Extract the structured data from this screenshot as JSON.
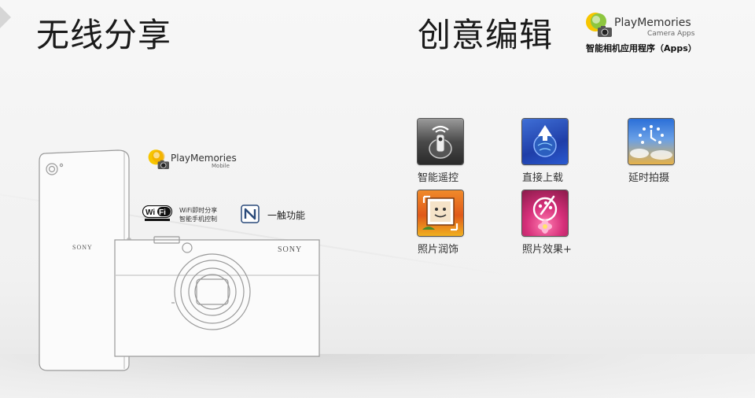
{
  "sections": {
    "wireless_title": "无线分享",
    "creative_title": "创意编辑"
  },
  "logos": {
    "camera_apps": {
      "name": "PlayMemories",
      "sub": "Camera Apps",
      "caption": "智能相机应用程序（Apps）"
    },
    "mobile": {
      "name": "PlayMemories",
      "sub": "Mobile"
    }
  },
  "features": {
    "wifi_badge_icon": "wifi-certified-icon",
    "wifi_line1": "WiFi即时分享",
    "wifi_line2": "智能手机控制",
    "nfc_icon": "nfc-icon",
    "nfc_label": "一触功能"
  },
  "device": {
    "phone_brand": "SONY",
    "camera_brand": "SONY"
  },
  "apps": [
    {
      "label": "智能遥控",
      "icon": "smart-remote-icon"
    },
    {
      "label": "直接上载",
      "icon": "direct-upload-icon"
    },
    {
      "label": "延时拍摄",
      "icon": "time-lapse-icon"
    },
    {
      "label": "照片润饰",
      "icon": "photo-retouch-icon"
    },
    {
      "label": "照片效果+",
      "icon": "picture-effect-plus-icon"
    }
  ],
  "colors": {
    "pm_green": "#8dc63f",
    "pm_yellow": "#f7c600",
    "outline": "#9a9a9a"
  }
}
